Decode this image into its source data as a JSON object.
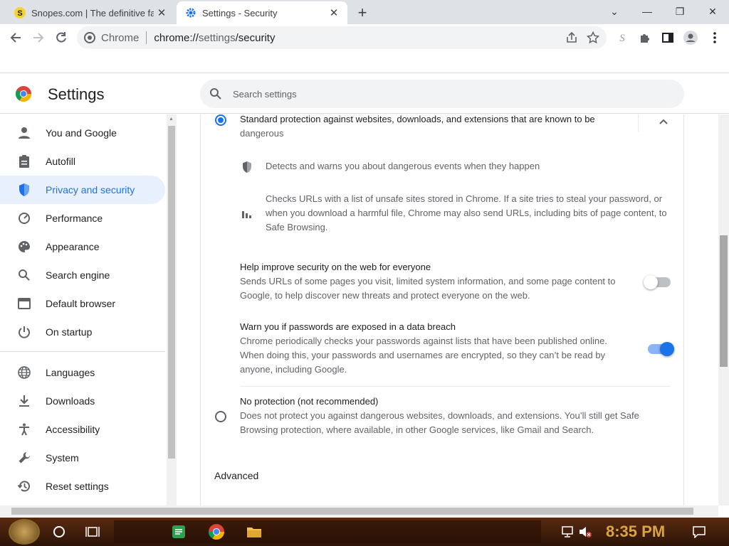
{
  "colors": {
    "accent": "#1a73e8",
    "active_nav_bg": "#e8f0fe",
    "clock": "#d9a441"
  },
  "browser": {
    "tabs": [
      {
        "title": "Snopes.com | The definitive fact",
        "icon": "snopes-icon",
        "close": "✕"
      },
      {
        "title": "Settings - Security",
        "icon": "gear-icon",
        "close": "✕"
      }
    ],
    "new_tab": "+",
    "omnibox": {
      "site": "Chrome",
      "url_prefix": "chrome://",
      "url_host": "settings",
      "url_path": "/security"
    },
    "window_controls": {
      "dropdown": "⌄",
      "minimize": "—",
      "restore": "❐",
      "close": "✕"
    }
  },
  "header": {
    "title": "Settings",
    "search_placeholder": "Search settings"
  },
  "sidebar": {
    "items": [
      {
        "label": "You and Google",
        "icon": "person-icon"
      },
      {
        "label": "Autofill",
        "icon": "clipboard-icon"
      },
      {
        "label": "Privacy and security",
        "icon": "shield-icon",
        "active": true
      },
      {
        "label": "Performance",
        "icon": "speedometer-icon"
      },
      {
        "label": "Appearance",
        "icon": "palette-icon"
      },
      {
        "label": "Search engine",
        "icon": "search-icon"
      },
      {
        "label": "Default browser",
        "icon": "browser-icon"
      },
      {
        "label": "On startup",
        "icon": "power-icon"
      },
      {
        "label": "Languages",
        "icon": "globe-icon"
      },
      {
        "label": "Downloads",
        "icon": "download-icon"
      },
      {
        "label": "Accessibility",
        "icon": "accessibility-icon"
      },
      {
        "label": "System",
        "icon": "wrench-icon"
      },
      {
        "label": "Reset settings",
        "icon": "history-icon"
      }
    ]
  },
  "main": {
    "standard": {
      "line1": "Standard protection against websites, downloads, and extensions that are known to be",
      "line2": "dangerous",
      "selected": true
    },
    "detail1": "Detects and warns you about dangerous events when they happen",
    "detail2": {
      "line1": "Checks URLs with a list of unsafe sites stored in Chrome. If a site tries to steal your password, or",
      "line2": "when you download a harmful file, Chrome may also send URLs, including bits of page content, to",
      "line3": "Safe Browsing."
    },
    "help_improve": {
      "title": "Help improve security on the web for everyone",
      "line1": "Sends URLs of some pages you visit, limited system information, and some page content to",
      "line2": "Google, to help discover new threats and protect everyone on the web.",
      "enabled": false
    },
    "password_warn": {
      "title": "Warn you if passwords are exposed in a data breach",
      "line1": "Chrome periodically checks your passwords against lists that have been published online.",
      "line2": "When doing this, your passwords and usernames are encrypted, so they can’t be read by",
      "line3": "anyone, including Google.",
      "enabled": true
    },
    "no_protection": {
      "title": "No protection (not recommended)",
      "line1": "Does not protect you against dangerous websites, downloads, and extensions. You’ll still get Safe",
      "line2": "Browsing protection, where available, in other Google services, like Gmail and Search.",
      "selected": false
    },
    "advanced": "Advanced"
  },
  "taskbar": {
    "clock": "8:35 PM"
  }
}
